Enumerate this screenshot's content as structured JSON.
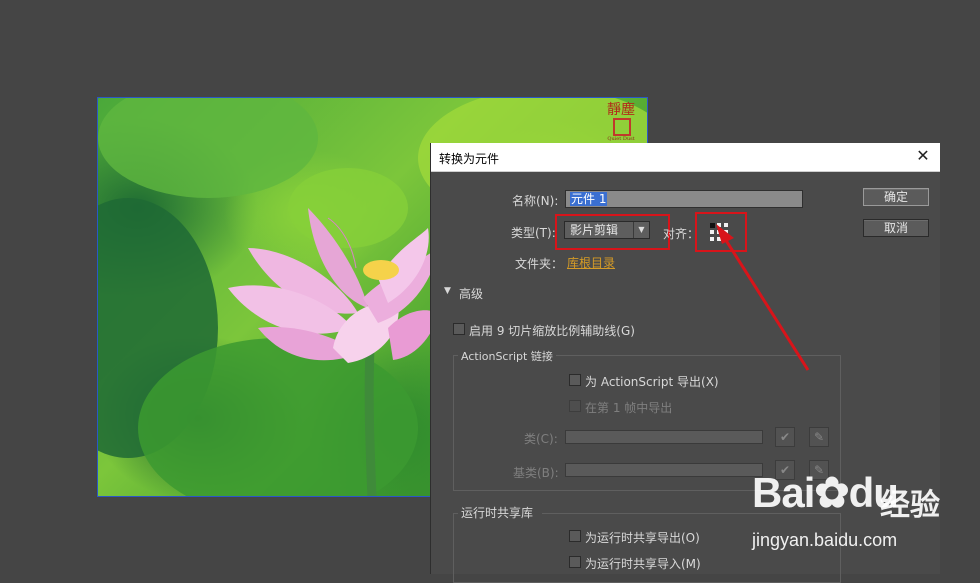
{
  "stage": {
    "seal_text": "靜塵",
    "seal_sub": "Quiet Dust"
  },
  "dialog": {
    "title": "转换为元件",
    "close_glyph": "✕",
    "name_label": "名称(N):",
    "name_value": "元件 1",
    "type_label": "类型(T):",
    "type_value": "影片剪辑",
    "align_label": "对齐：",
    "folder_label": "文件夹：",
    "folder_value": "库根目录",
    "ok_label": "确定",
    "cancel_label": "取消",
    "advanced_label": "高级",
    "nine_slice_label": "启用 9 切片缩放比例辅助线(G)",
    "actionscript": {
      "group_label": "ActionScript 链接",
      "export_label": "为 ActionScript 导出(X)",
      "frame1_label": "在第 1 帧中导出",
      "class_label": "类(C):",
      "base_class_label": "基类(B):"
    },
    "runtime": {
      "group_label": "运行时共享库",
      "export_label": "为运行时共享导出(O)",
      "import_label": "为运行时共享导入(M)"
    }
  },
  "watermark": {
    "brand": "Bai",
    "brand_suffix": "du",
    "cn": "经验",
    "url": "jingyan.baidu.com"
  },
  "colors": {
    "highlight_red": "#d8141a",
    "link_orange": "#d59b26",
    "selection_blue": "#3a6fd1"
  }
}
